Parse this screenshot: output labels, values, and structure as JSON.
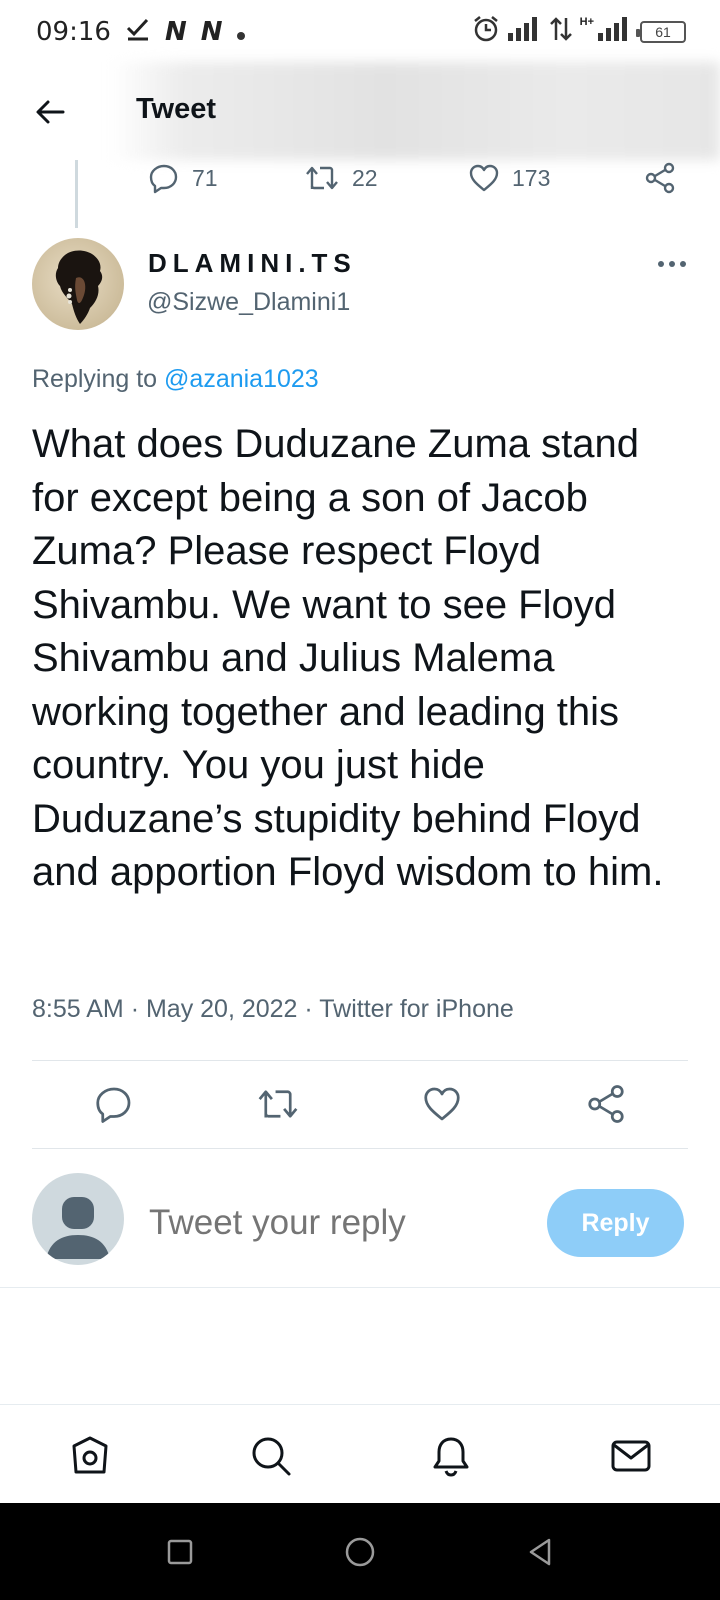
{
  "status_bar": {
    "time": "09:16",
    "notification_icons": [
      "check-icon",
      "n-app-icon",
      "n-app-icon",
      "dot-icon"
    ],
    "n_badge": "N",
    "right_icons": [
      "alarm-icon",
      "signal-icon",
      "data-arrows-icon",
      "hplus-signal-icon"
    ],
    "network_type": "H+",
    "battery": "61"
  },
  "header": {
    "title": "Tweet",
    "back_icon": "arrow-left-icon"
  },
  "previous_tweet_actions": {
    "replies": "71",
    "retweets": "22",
    "likes": "173"
  },
  "tweet": {
    "display_name": "DLAMINI.TS",
    "handle": "@Sizwe_Dlamini1",
    "replying_prefix": "Replying to",
    "replying_to": "@azania1023",
    "text": "What does Duduzane Zuma stand for except being a son of Jacob Zuma? Please respect Floyd Shivambu. We want to see Floyd Shivambu and Julius Malema working together and leading this country. You you just hide Duduzane’s stupidity behind Floyd and apportion Floyd wisdom to him.",
    "time": "8:55 AM",
    "separator": "·",
    "date": "May 20, 2022",
    "source": "Twitter for iPhone"
  },
  "actions": [
    "reply-icon",
    "retweet-icon",
    "like-icon",
    "share-icon"
  ],
  "reply_composer": {
    "placeholder": "Tweet your reply",
    "button_label": "Reply"
  },
  "bottom_nav": [
    "home-icon",
    "search-icon",
    "notifications-icon",
    "messages-icon"
  ],
  "system_nav": [
    "recents-icon",
    "home-circle-icon",
    "back-triangle-icon"
  ],
  "colors": {
    "accent": "#1d9bf0",
    "reply_button": "#8ecdf8",
    "secondary_text": "#536471",
    "primary_text": "#0f1419"
  }
}
